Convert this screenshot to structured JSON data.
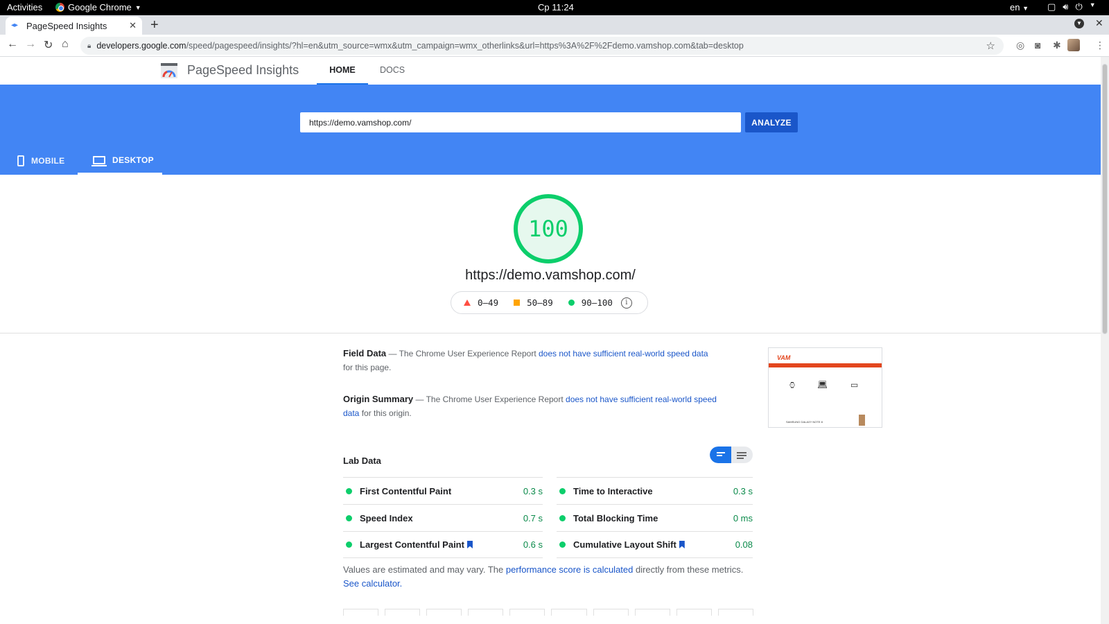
{
  "system_bar": {
    "activities": "Activities",
    "app_name": "Google Chrome",
    "clock": "Ср 11:24",
    "language": "en"
  },
  "browser": {
    "tab_title": "PageSpeed Insights",
    "url_domain": "developers.google.com",
    "url_rest": "/speed/pagespeed/insights/?hl=en&utm_source=wmx&utm_campaign=wmx_otherlinks&url=https%3A%2F%2Fdemo.vamshop.com&tab=desktop"
  },
  "header": {
    "title": "PageSpeed Insights",
    "nav": {
      "home": "HOME",
      "docs": "DOCS"
    }
  },
  "analyze_form": {
    "url_value": "https://demo.vamshop.com/",
    "analyze_label": "ANALYZE"
  },
  "device_tabs": {
    "mobile": "MOBILE",
    "desktop": "DESKTOP",
    "selected": "desktop"
  },
  "score": {
    "value": "100",
    "tested_url": "https://demo.vamshop.com/",
    "color": "#0cce6b",
    "legend": {
      "fail": "0–49",
      "average": "50–89",
      "pass": "90–100"
    }
  },
  "field_data": {
    "title": "Field Data",
    "text_before": " — The Chrome User Experience Report ",
    "link": "does not have sufficient real-world speed data",
    "text_after": " for this page."
  },
  "origin_summary": {
    "title": "Origin Summary",
    "text_before": " — The Chrome User Experience Report ",
    "link": "does not have sufficient real-world speed data",
    "text_after": " for this origin."
  },
  "thumbnail": {
    "logo": "VAM",
    "caption": "SAMSUNG GALAXY NOTE 8"
  },
  "lab_data": {
    "title": "Lab Data",
    "metrics": [
      {
        "label": "First Contentful Paint",
        "value": "0.3 s"
      },
      {
        "label": "Time to Interactive",
        "value": "0.3 s"
      },
      {
        "label": "Speed Index",
        "value": "0.7 s"
      },
      {
        "label": "Total Blocking Time",
        "value": "0 ms"
      },
      {
        "label": "Largest Contentful Paint",
        "value": "0.6 s"
      },
      {
        "label": "Cumulative Layout Shift",
        "value": "0.08"
      }
    ]
  },
  "note": {
    "text1": "Values are estimated and may vary. The ",
    "link1": "performance score is calculated",
    "text2": " directly from these metrics. ",
    "link2": "See calculator."
  }
}
